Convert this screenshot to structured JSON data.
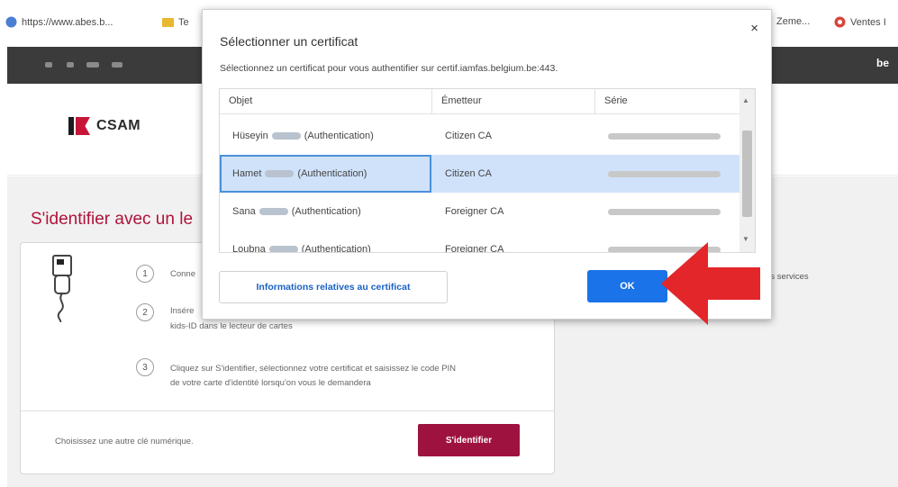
{
  "bookmarks": {
    "items": [
      {
        "label": "https://www.abes.b...",
        "icon": "globe-icon",
        "color": "#4a7fd4"
      },
      {
        "label": "Te",
        "icon": "folder-icon",
        "color": "#e8b831"
      },
      {
        "label": "Zeme...",
        "icon": "",
        "color": ""
      },
      {
        "label": "Ventes I",
        "icon": "shopping-icon",
        "color": "#d9453b"
      }
    ]
  },
  "toolbar": {
    "right_label": "be"
  },
  "site": {
    "logo_text": "CSAM",
    "heading": "S'identifier avec un le",
    "steps": [
      {
        "number": "1",
        "text": "Conne"
      },
      {
        "number": "2",
        "text": "Insére",
        "text2": "kids-ID dans le lecteur de cartes"
      },
      {
        "number": "3",
        "text": "Cliquez sur S'identifier, sélectionnez votre certificat et saisissez le code PIN",
        "text2": "de votre carte d'identité lorsqu'on vous le demandera"
      }
    ],
    "choose_other": "Choisissez une autre clé numérique.",
    "identify_button": "S'identifier",
    "right_services": "les services"
  },
  "dialog": {
    "title": "Sélectionner un certificat",
    "subtitle": "Sélectionnez un certificat pour vous authentifier sur certif.iamfas.belgium.be:443.",
    "close": "×",
    "columns": [
      "Objet",
      "Émetteur",
      "Série"
    ],
    "rows": [
      {
        "first": "Hüseyin",
        "last": "(Authentication)",
        "issuer": "Citizen CA",
        "selected": false
      },
      {
        "first": "Hamet",
        "last": "(Authentication)",
        "issuer": "Citizen CA",
        "selected": true
      },
      {
        "first": "Sana",
        "last": "(Authentication)",
        "issuer": "Foreigner CA",
        "selected": false
      },
      {
        "first": "Loubna",
        "last": "(Authentication)",
        "issuer": "Foreigner CA",
        "selected": false
      }
    ],
    "info_button": "Informations relatives au certificat",
    "ok_button": "OK"
  },
  "colors": {
    "accent_red": "#b0123a",
    "identify_button": "#9e1240",
    "ok_blue": "#1a73e8",
    "arrow_red": "#e3262a"
  }
}
